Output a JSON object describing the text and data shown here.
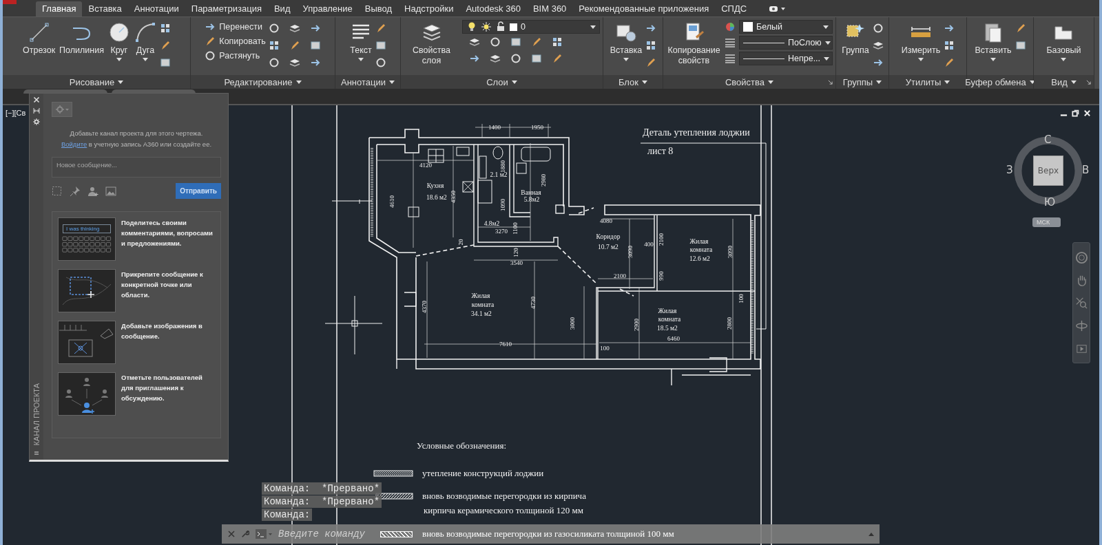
{
  "menu_tabs": [
    {
      "label": "Главная",
      "selected": true
    },
    {
      "label": "Вставка",
      "selected": false
    },
    {
      "label": "Аннотации",
      "selected": false
    },
    {
      "label": "Параметризация",
      "selected": false
    },
    {
      "label": "Вид",
      "selected": false
    },
    {
      "label": "Управление",
      "selected": false
    },
    {
      "label": "Вывод",
      "selected": false
    },
    {
      "label": "Надстройки",
      "selected": false
    },
    {
      "label": "Autodesk 360",
      "selected": false
    },
    {
      "label": "BIM 360",
      "selected": false
    },
    {
      "label": "Рекомендованные приложения",
      "selected": false
    },
    {
      "label": "СПДС",
      "selected": false
    }
  ],
  "ribbon_panels": [
    {
      "title": "Рисование",
      "launcher": false,
      "items": [
        {
          "kind": "large",
          "label": "Отрезок",
          "dropdown": false
        },
        {
          "kind": "large",
          "label": "Полилиния",
          "dropdown": false
        },
        {
          "kind": "large",
          "label": "Круг",
          "dropdown": true
        },
        {
          "kind": "large",
          "label": "Дуга",
          "dropdown": true
        },
        {
          "kind": "icon_column"
        }
      ]
    },
    {
      "title": "Редактирование",
      "launcher": false,
      "items": [
        {
          "kind": "small_list",
          "tools": [
            "Перенести",
            "Копировать",
            "Растянуть"
          ]
        },
        {
          "kind": "icon_grid"
        }
      ]
    },
    {
      "title": "Аннотации",
      "launcher": false,
      "items": [
        {
          "kind": "large",
          "label": "Текст",
          "dropdown": true
        },
        {
          "kind": "icon_column"
        }
      ]
    },
    {
      "title": "Слои",
      "launcher": false,
      "items": [
        {
          "kind": "large",
          "label": "Свойства слоя",
          "dropdown": false
        },
        {
          "kind": "layer_block",
          "value": "0"
        }
      ]
    },
    {
      "title": "Блок",
      "launcher": false,
      "items": [
        {
          "kind": "large",
          "label": "Вставка",
          "dropdown": true
        },
        {
          "kind": "icon_column"
        }
      ]
    },
    {
      "title": "Свойства",
      "launcher": true,
      "items": [
        {
          "kind": "large",
          "label": "Копирование свойств",
          "dropdown": false
        },
        {
          "kind": "combos",
          "combos": [
            {
              "kind": "color",
              "value": "Белый"
            },
            {
              "kind": "line",
              "value": "ПоСлою"
            },
            {
              "kind": "line",
              "value": "Непре..."
            }
          ]
        }
      ]
    },
    {
      "title": "Группы",
      "launcher": false,
      "items": [
        {
          "kind": "large",
          "label": "Группа",
          "dropdown": false
        },
        {
          "kind": "icon_column"
        }
      ]
    },
    {
      "title": "Утилиты",
      "launcher": false,
      "items": [
        {
          "kind": "large",
          "label": "Измерить",
          "dropdown": true
        },
        {
          "kind": "icon_column"
        }
      ]
    },
    {
      "title": "Буфер обмена",
      "launcher": false,
      "items": [
        {
          "kind": "large",
          "label": "Вставить",
          "dropdown": true
        },
        {
          "kind": "icon_pair"
        }
      ]
    },
    {
      "title": "Вид",
      "launcher": true,
      "items": [
        {
          "kind": "large",
          "label": "Базовый",
          "dropdown": true
        }
      ]
    }
  ],
  "viewport_label": "[−][Св",
  "palette": {
    "title": "КАНАЛ ПРОЕКТА",
    "info": {
      "text": "Добавьте канал проекта для этого чертежа.",
      "link": "Войдите",
      "after": " в учетную запись A360 или создайте ее."
    },
    "message_placeholder": "Новое сообщение...",
    "send_button": "Отправить",
    "tips": [
      {
        "kind": "text",
        "sample": "I was thinking",
        "text": "Поделитесь своими комментариями, вопросами и предложениями."
      },
      {
        "kind": "area",
        "text": "Прикрепите сообщение к конкретной точке или области."
      },
      {
        "kind": "image",
        "text": "Добавьте изображения в сообщение."
      },
      {
        "kind": "users",
        "text": "Отметьте пользователей для приглашения к обсуждению."
      }
    ]
  },
  "drawing": {
    "title": "Деталь утепления лоджии",
    "sheet": "лист  8",
    "plan_labels": [
      {
        "kind": "dim",
        "text": "1400"
      },
      {
        "kind": "dim",
        "text": "1950"
      },
      {
        "kind": "dim",
        "text": "4120"
      },
      {
        "kind": "room",
        "text": "Кухня"
      },
      {
        "kind": "room",
        "text": "18.6 м2"
      },
      {
        "kind": "dim",
        "text": "4350"
      },
      {
        "kind": "dim",
        "text": "4610"
      },
      {
        "kind": "room",
        "text": "2.1 м2"
      },
      {
        "kind": "dim",
        "text": "1880"
      },
      {
        "kind": "room",
        "text": "Ванная"
      },
      {
        "kind": "room",
        "text": "5.8м2"
      },
      {
        "kind": "dim",
        "text": "2980"
      },
      {
        "kind": "dim",
        "text": "1090"
      },
      {
        "kind": "room",
        "text": "4.8м2"
      },
      {
        "kind": "dim",
        "text": "3270"
      },
      {
        "kind": "dim",
        "text": "1100"
      },
      {
        "kind": "dim",
        "text": "20"
      },
      {
        "kind": "dim",
        "text": "120"
      },
      {
        "kind": "dim",
        "text": "3540"
      },
      {
        "kind": "dim",
        "text": "4080"
      },
      {
        "kind": "room",
        "text": "Коридор"
      },
      {
        "kind": "room",
        "text": "10.7 м2"
      },
      {
        "kind": "dim",
        "text": "3090"
      },
      {
        "kind": "dim",
        "text": "400"
      },
      {
        "kind": "dim",
        "text": "2100"
      },
      {
        "kind": "room",
        "text": "Жилая"
      },
      {
        "kind": "room",
        "text": "комната"
      },
      {
        "kind": "room",
        "text": "12.6 м2"
      },
      {
        "kind": "dim",
        "text": "3090"
      },
      {
        "kind": "dim",
        "text": "990"
      },
      {
        "kind": "dim",
        "text": "2100"
      },
      {
        "kind": "room",
        "text": "Жилая"
      },
      {
        "kind": "room",
        "text": "комната"
      },
      {
        "kind": "room",
        "text": "34.1 м2"
      },
      {
        "kind": "dim",
        "text": "4730"
      },
      {
        "kind": "dim",
        "text": "4370"
      },
      {
        "kind": "dim",
        "text": "3000"
      },
      {
        "kind": "dim",
        "text": "2900"
      },
      {
        "kind": "room",
        "text": "Жилая"
      },
      {
        "kind": "room",
        "text": "комната"
      },
      {
        "kind": "room",
        "text": "18.5 м2"
      },
      {
        "kind": "dim",
        "text": "6460"
      },
      {
        "kind": "dim",
        "text": "2800"
      },
      {
        "kind": "dim",
        "text": "100"
      },
      {
        "kind": "dim",
        "text": "7610"
      },
      {
        "kind": "dim",
        "text": "100"
      }
    ],
    "legend_title": "Условные обозначения:",
    "legend": [
      {
        "kind": "insulation",
        "lines": [
          "утепление конструкций лоджии"
        ]
      },
      {
        "kind": "brick",
        "lines": [
          "вновь возводимые  перегородки из кирпича",
          "кирпича керамического толщиной 120 мм"
        ]
      },
      {
        "kind": "gas_block",
        "lines": [
          "вновь возводимые перегородки из газосиликата толщиной 100 мм"
        ]
      }
    ]
  },
  "viewcube": {
    "top": "Верх",
    "north": "С",
    "south": "Ю",
    "west": "З",
    "east": "В",
    "ucs": "МСК"
  },
  "command_line": {
    "history": [
      "Команда:  *Прервано*",
      "Команда:  *Прервано*",
      "Команда:"
    ],
    "placeholder": "Введите команду"
  }
}
